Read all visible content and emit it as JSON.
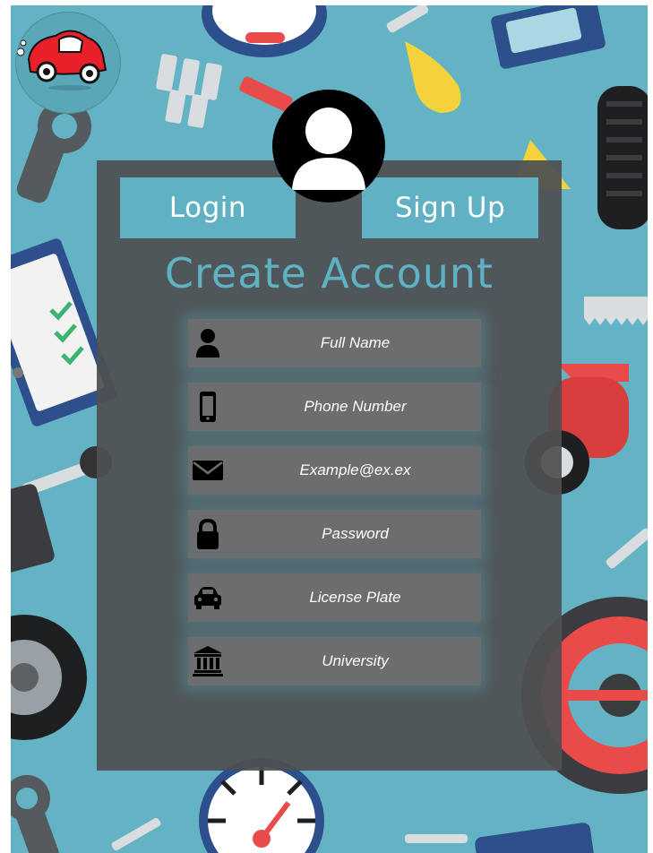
{
  "tabs": {
    "login_label": "Login",
    "signup_label": "Sign Up"
  },
  "heading": "Create Account",
  "fields": [
    {
      "placeholder": "Full Name",
      "icon": "user-icon"
    },
    {
      "placeholder": "Phone Number",
      "icon": "phone-icon"
    },
    {
      "placeholder": "Example@ex.ex",
      "icon": "envelope-icon"
    },
    {
      "placeholder": "Password",
      "icon": "lock-icon"
    },
    {
      "placeholder": "License Plate",
      "icon": "car-icon"
    },
    {
      "placeholder": "University",
      "icon": "university-icon"
    }
  ],
  "colors": {
    "background": "#63b3c4",
    "accent": "#5fb1c3",
    "panel": "#4e5052",
    "field": "#6b6d6e"
  }
}
